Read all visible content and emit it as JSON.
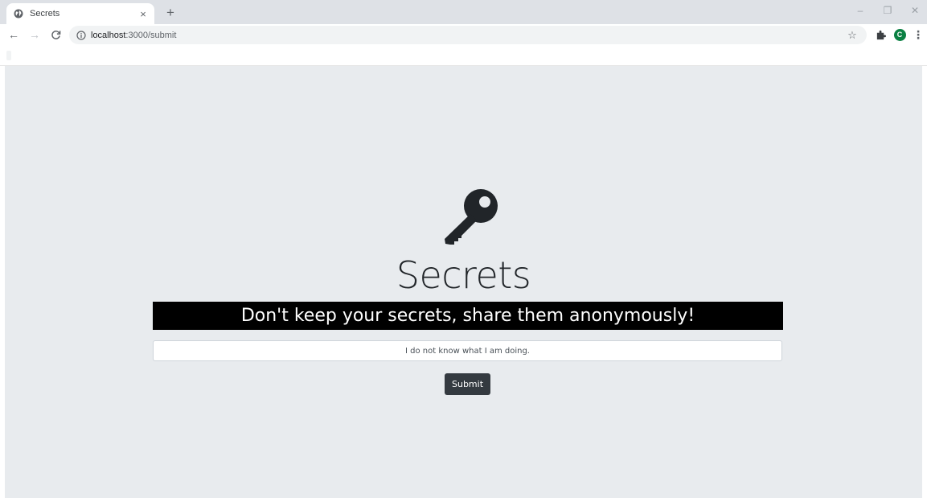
{
  "browser": {
    "tab": {
      "title": "Secrets",
      "close_icon": "×",
      "favicon": "globe-icon"
    },
    "new_tab_icon": "+",
    "window_controls": {
      "minimize": "–",
      "maximize": "❐",
      "close": "✕"
    },
    "toolbar": {
      "back": "←",
      "forward": "→",
      "reload": "C",
      "url_host": "localhost",
      "url_path": ":3000/submit",
      "star_icon": "☆",
      "extensions_icon": "puzzle-icon",
      "avatar_letter": "C",
      "menu_icon": "⋮"
    }
  },
  "page": {
    "title": "Secrets",
    "tagline": "Don't keep your secrets, share them anonymously!",
    "secret_input": {
      "value": "I do not know what I am doing."
    },
    "submit_label": "Submit",
    "key_icon": "key-icon"
  },
  "colors": {
    "page_background": "#e8ebee",
    "tagline_background": "#000000",
    "button_background": "#343a40",
    "avatar": "#0b8043"
  }
}
